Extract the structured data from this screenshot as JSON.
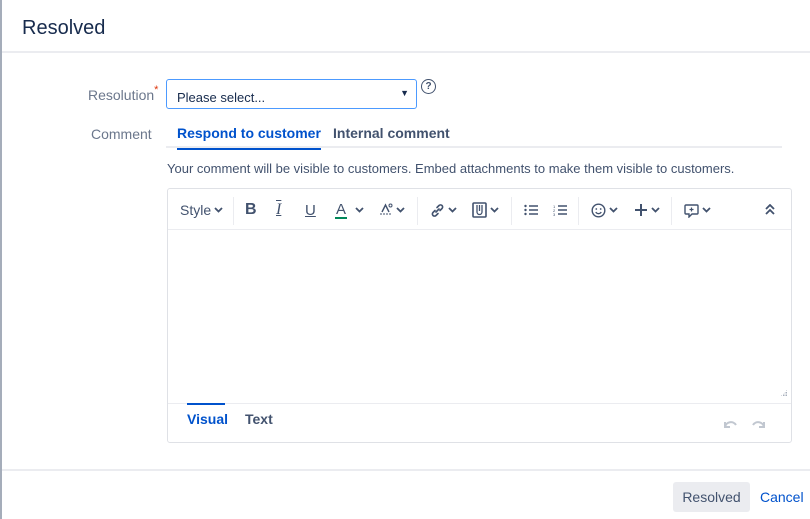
{
  "dialog": {
    "title": "Resolved"
  },
  "resolution": {
    "label": "Resolution",
    "required_marker": "*",
    "selected_value": "Please select...",
    "help_icon": "question-circle-icon"
  },
  "comment": {
    "label": "Comment",
    "tabs": [
      {
        "label": "Respond to customer",
        "active": true
      },
      {
        "label": "Internal comment",
        "active": false
      }
    ],
    "hint": "Your comment will be visible to customers. Embed attachments to make them visible to customers."
  },
  "editor": {
    "toolbar": {
      "style_label": "Style",
      "icons": [
        "bold-icon",
        "italic-icon",
        "underline-icon",
        "text-color-icon",
        "text-format-icon",
        "link-icon",
        "attachment-icon",
        "bullet-list-icon",
        "numbered-list-icon",
        "emoji-icon",
        "insert-more-icon",
        "canned-response-icon",
        "collapse-toolbar-icon"
      ],
      "text_color": "#00875a"
    },
    "content": "",
    "modes": [
      {
        "label": "Visual",
        "active": true
      },
      {
        "label": "Text",
        "active": false
      }
    ]
  },
  "footer": {
    "submit_label": "Resolved",
    "cancel_label": "Cancel"
  },
  "colors": {
    "accent": "#0052cc",
    "required": "#de350b"
  }
}
